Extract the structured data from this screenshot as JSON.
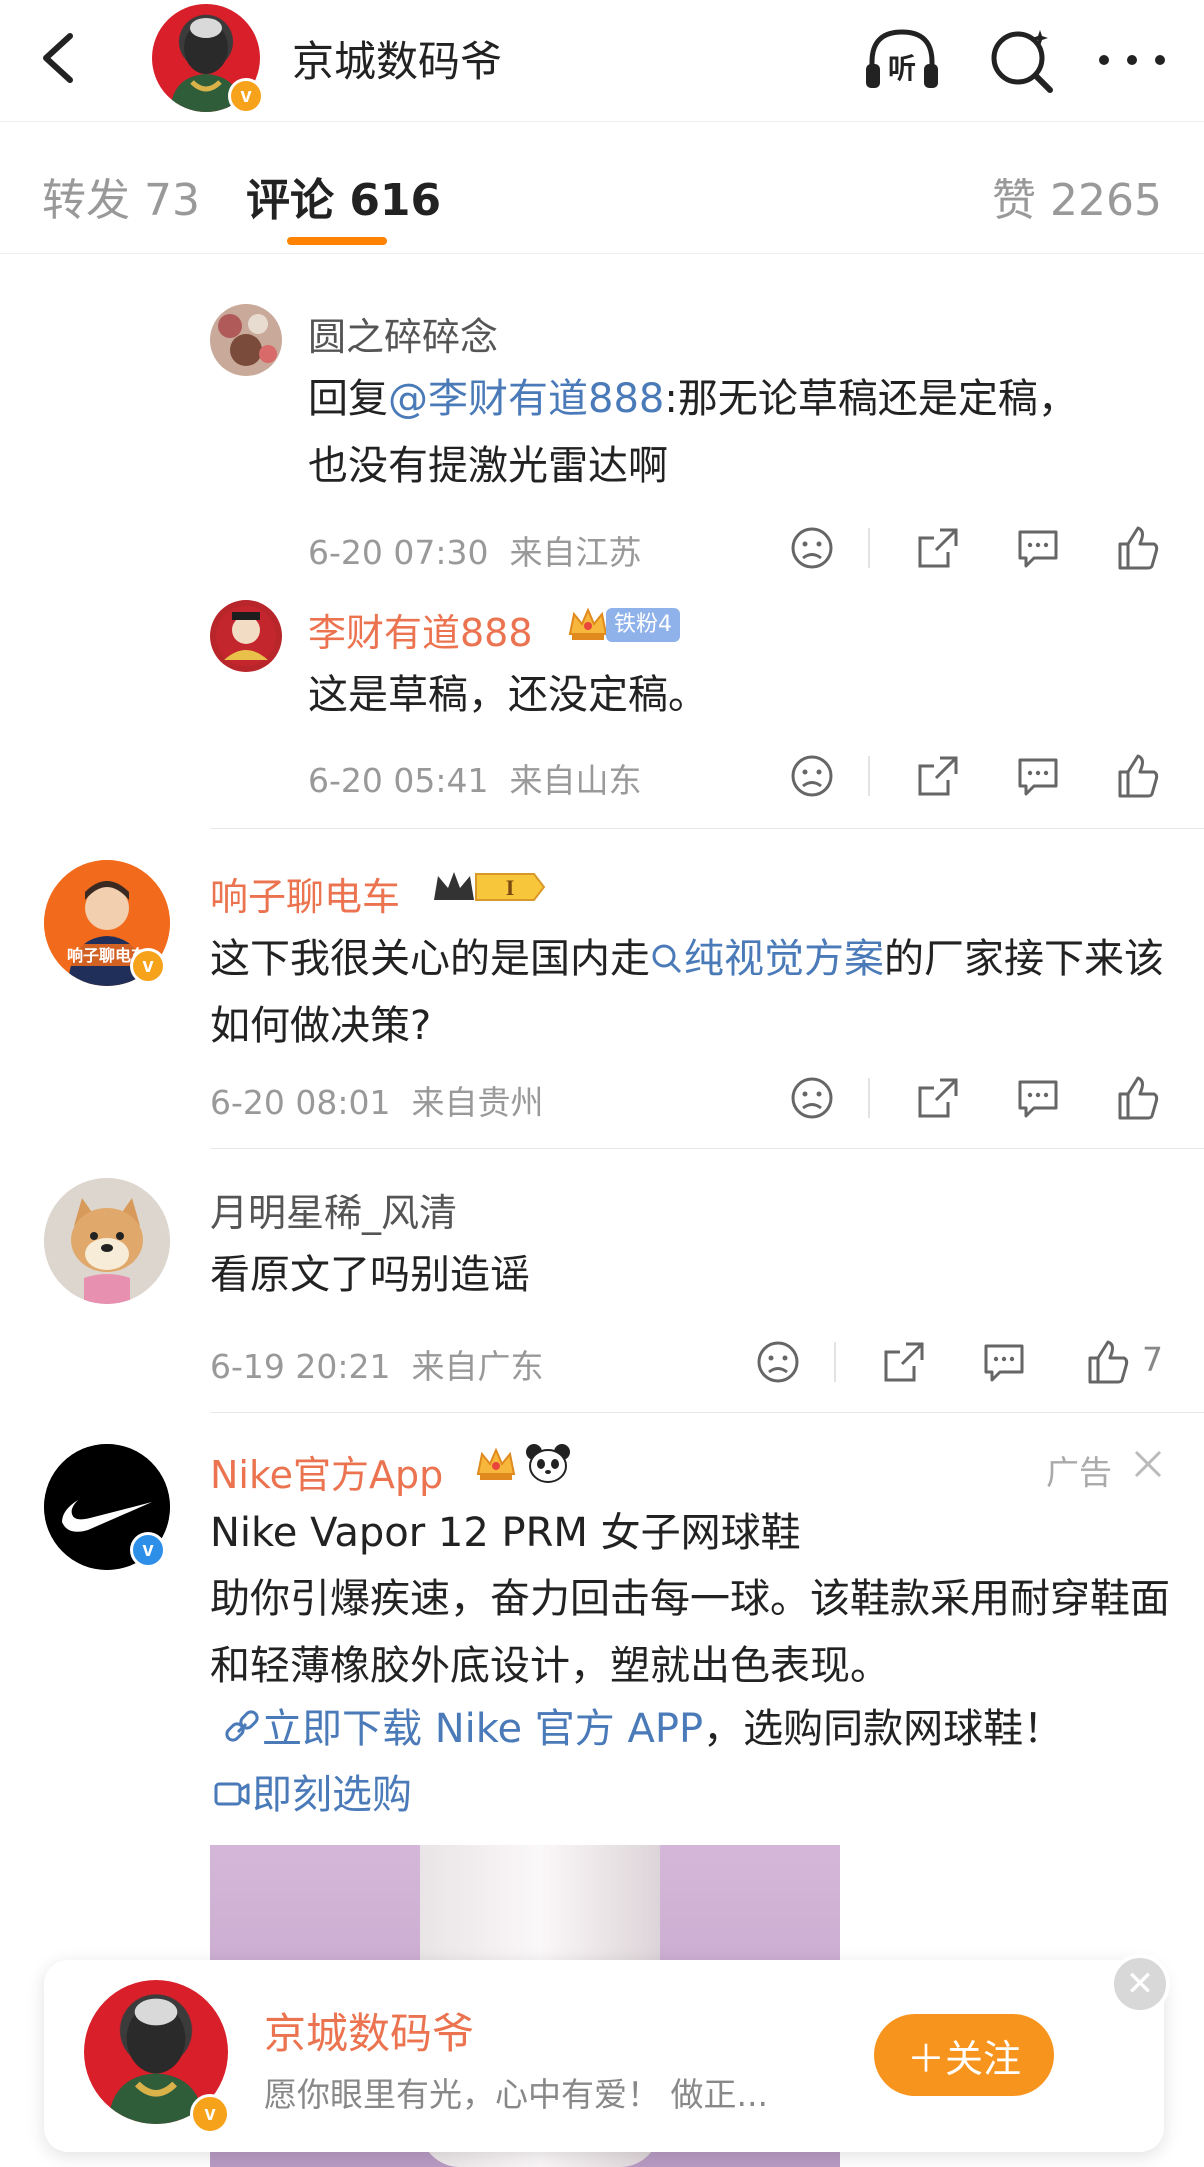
{
  "header": {
    "title": "京城数码爷",
    "listen_label": "听"
  },
  "tabs": [
    {
      "label": "转发 73"
    },
    {
      "label": "评论 616"
    },
    {
      "label": "赞 2265"
    }
  ],
  "replies": [
    {
      "user": "圆之碎碎念",
      "text_prefix": "回复",
      "mention": "@李财有道888",
      "text_suffix": ":那无论草稿还是定稿，也没有提激光雷达啊",
      "time": "6-20 07:30",
      "location": "来自江苏"
    },
    {
      "user": "李财有道888",
      "fan_badge": "铁粉4",
      "text": "这是草稿，还没定稿。",
      "time": "6-20 05:41",
      "location": "来自山东"
    }
  ],
  "comments": [
    {
      "user": "响子聊电车",
      "avatar_text": "响子聊电车",
      "level_badge": "I",
      "text_prefix": "这下我很关心的是国内走",
      "topic": "纯视觉方案",
      "text_suffix": "的厂家接下来该如何做决策?",
      "time": "6-20 08:01",
      "location": "来自贵州"
    },
    {
      "user": "月明星稀_风清",
      "text": "看原文了吗别造谣",
      "time": "6-19 20:21",
      "location": "来自广东",
      "likes": "7"
    }
  ],
  "ad": {
    "user": "Nike官方App",
    "tag": "广告",
    "title": "Nike Vapor 12 PRM  女子网球鞋",
    "body": "助你引爆疾速，奋力回击每一球。该鞋款采用耐穿鞋面和轻薄橡胶外底设计，塑就出色表现。",
    "link_text": "立即下载 Nike 官方 APP",
    "link_suffix": "，选购同款网球鞋！",
    "action_text": "即刻选购"
  },
  "follow_card": {
    "name": "京城数码爷",
    "desc": "愿你眼里有光，心中有爱！  做正...",
    "button": "＋关注"
  },
  "colors": {
    "accent": "#ff8200",
    "name_orange": "#eb7350",
    "link_blue": "#4a7ab8",
    "verify_orange": "#f7a21b",
    "verify_blue": "#2d8fe8"
  }
}
